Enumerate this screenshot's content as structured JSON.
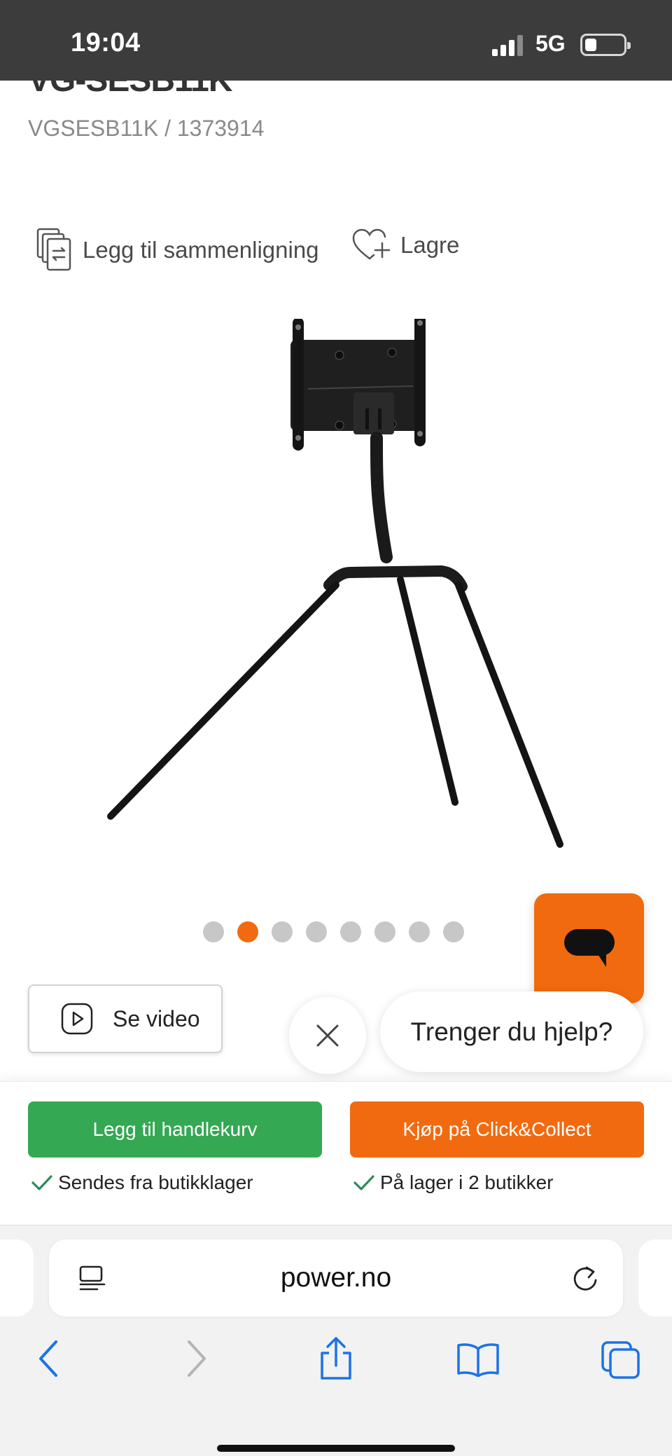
{
  "status_bar": {
    "time": "19:04",
    "network": "5G"
  },
  "product": {
    "title_partial": "VG-SESB11K",
    "sku": "VGSESB11K / 1373914"
  },
  "actions": {
    "compare_label": "Legg til sammenligning",
    "save_label": "Lagre"
  },
  "gallery": {
    "image_count": 8,
    "active_index": 2
  },
  "video_button": {
    "label": "Se video"
  },
  "help": {
    "bubble_text": "Trenger du hjelp?"
  },
  "buy": {
    "add_to_cart": "Legg til handlekurv",
    "click_collect": "Kjøp på Click&Collect",
    "stock_shipping": "Sendes fra butikklager",
    "stock_store": "På lager i 2 butikker"
  },
  "browser": {
    "url": "power.no"
  },
  "colors": {
    "accent": "#f26a0f",
    "green": "#34a853",
    "check": "#2e8b57"
  },
  "icons": [
    "compare-icon",
    "heart-plus-icon",
    "chat-icon",
    "play-icon",
    "close-icon",
    "checkmark-icon",
    "reader-icon",
    "reload-icon",
    "back-icon",
    "forward-icon",
    "share-icon",
    "bookmarks-icon",
    "tabs-icon"
  ]
}
